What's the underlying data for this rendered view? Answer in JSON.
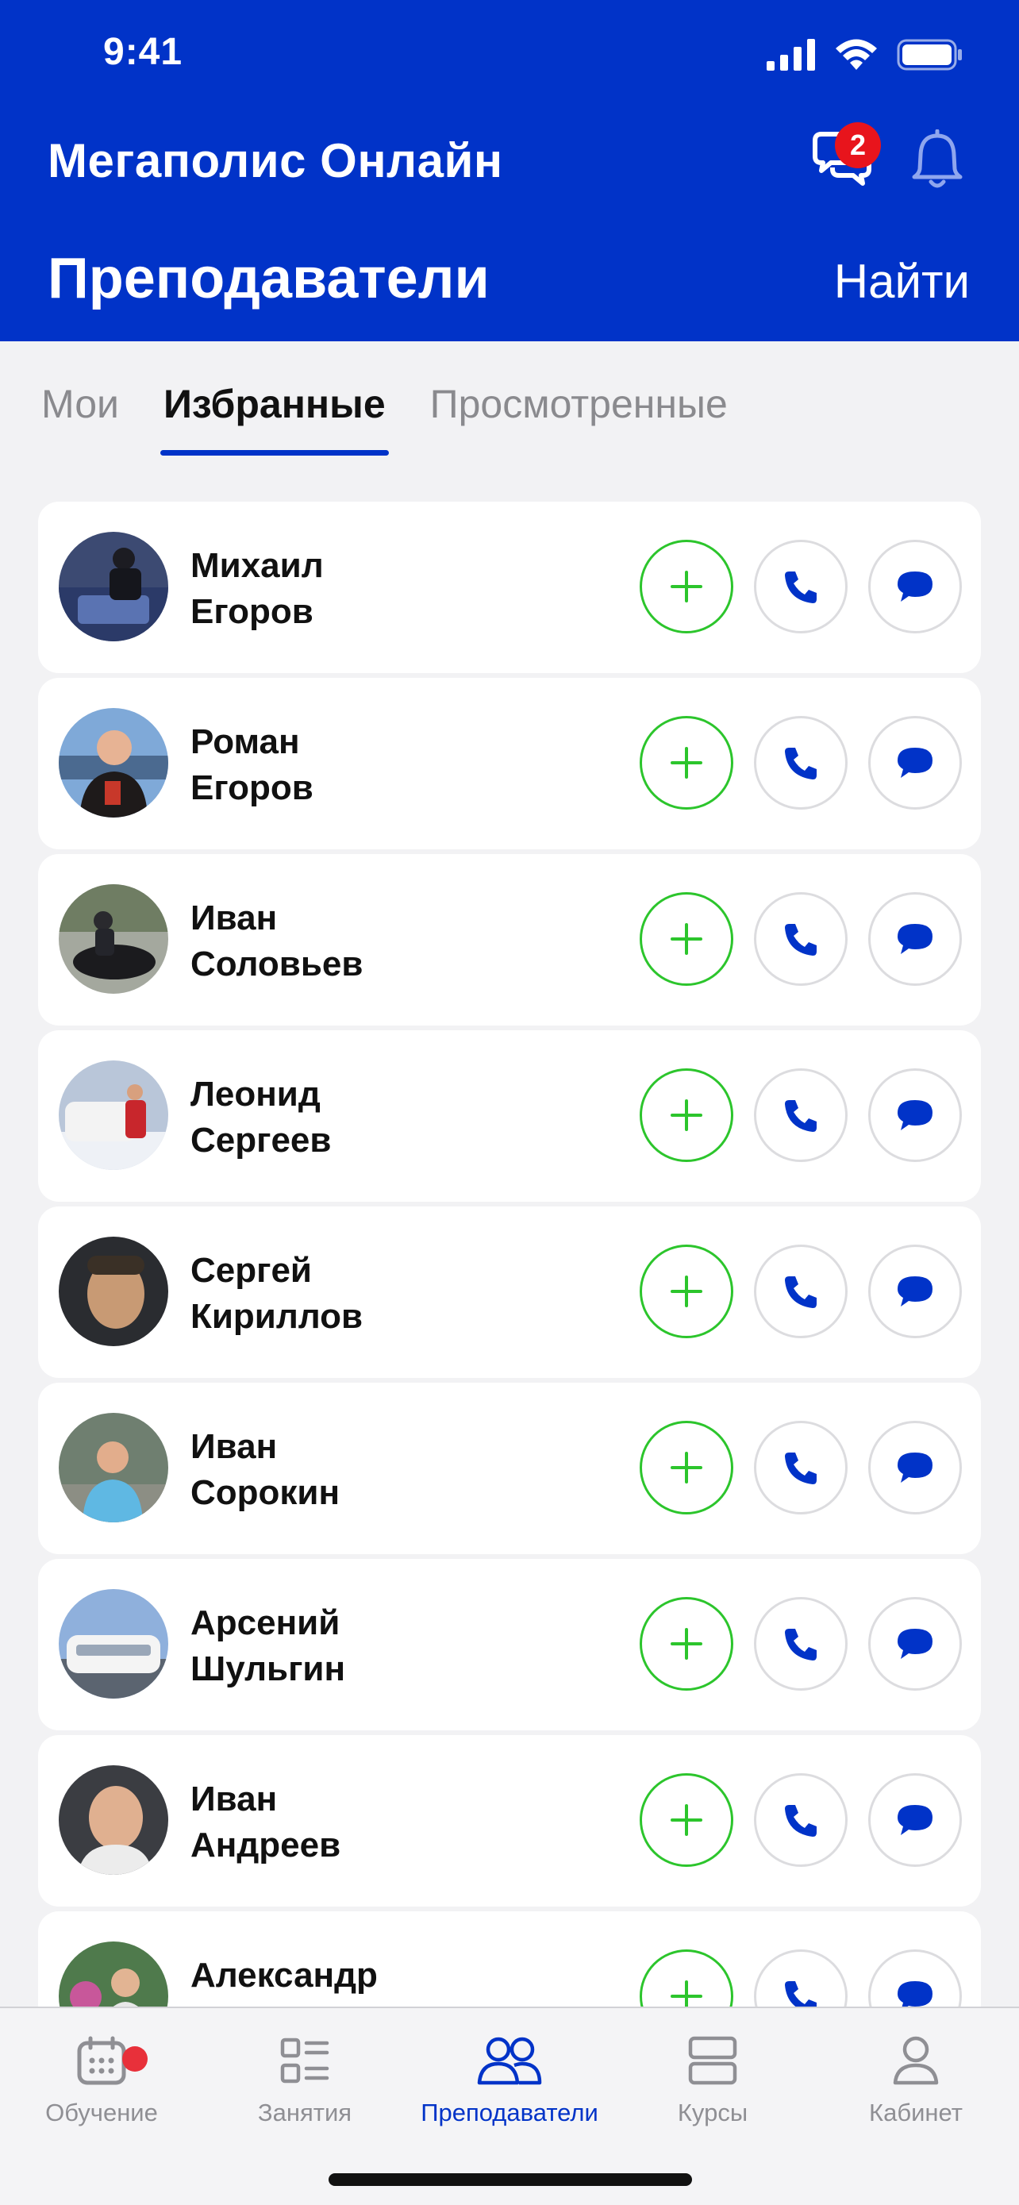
{
  "status_bar": {
    "time": "9:41"
  },
  "header": {
    "brand": "Мегаполис Онлайн",
    "chat_badge": "2",
    "page_title": "Преподаватели",
    "find_label": "Найти"
  },
  "tabs": [
    {
      "label": "Мои"
    },
    {
      "label": "Избранные"
    },
    {
      "label": "Просмотренные"
    }
  ],
  "teachers": [
    {
      "first": "Михаил",
      "last": "Егоров"
    },
    {
      "first": "Роман",
      "last": "Егоров"
    },
    {
      "first": "Иван",
      "last": "Соловьев"
    },
    {
      "first": "Леонид",
      "last": "Сергеев"
    },
    {
      "first": "Сергей",
      "last": "Кириллов"
    },
    {
      "first": "Иван",
      "last": "Сорокин"
    },
    {
      "first": "Арсений",
      "last": "Шульгин"
    },
    {
      "first": "Иван",
      "last": "Андреев"
    },
    {
      "first": "Александр",
      "last": ""
    }
  ],
  "nav": [
    {
      "label": "Обучение",
      "icon": "calendar-icon"
    },
    {
      "label": "Занятия",
      "icon": "list-icon"
    },
    {
      "label": "Преподаватели",
      "icon": "people-icon"
    },
    {
      "label": "Курсы",
      "icon": "stack-icon"
    },
    {
      "label": "Кабинет",
      "icon": "person-icon"
    }
  ],
  "colors": {
    "brand_blue": "#0133C8",
    "add_green": "#2CC52C",
    "badge_red": "#E8141C"
  }
}
